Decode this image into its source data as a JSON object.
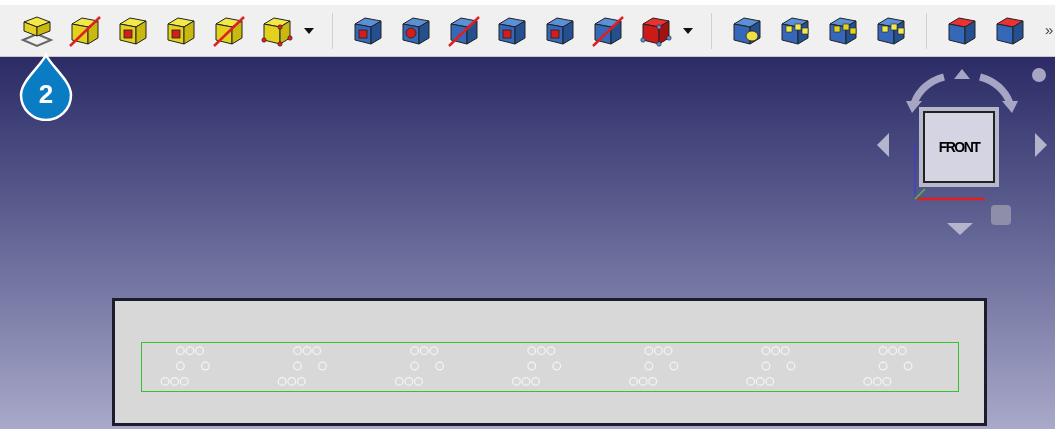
{
  "toolbar": {
    "overflow": "»"
  },
  "callout": {
    "number": "2"
  },
  "nav_cube": {
    "face": "FRONT"
  }
}
